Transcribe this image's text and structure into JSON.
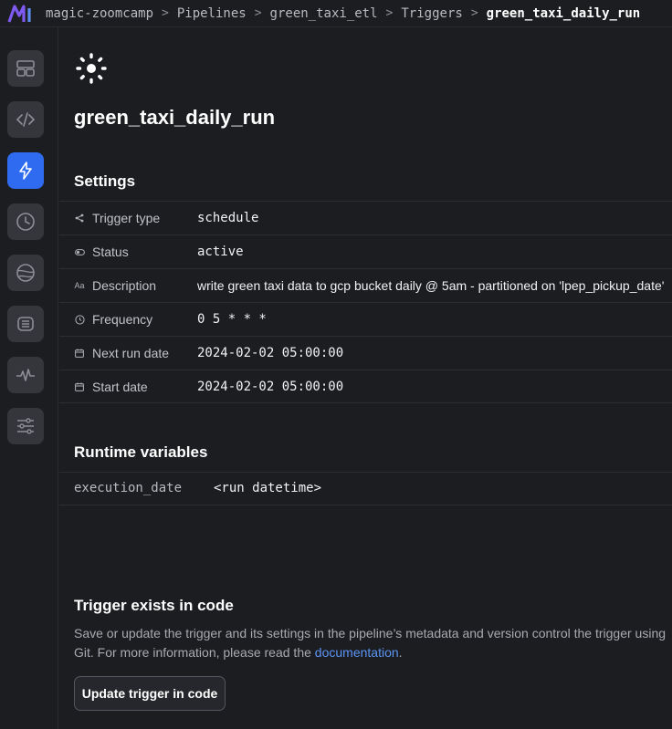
{
  "breadcrumbs": [
    {
      "label": "magic-zoomcamp"
    },
    {
      "label": "Pipelines"
    },
    {
      "label": "green_taxi_etl"
    },
    {
      "label": "Triggers"
    },
    {
      "label": "green_taxi_daily_run"
    }
  ],
  "sidebar": {
    "items": [
      {
        "icon": "dashboard-icon",
        "active": false
      },
      {
        "icon": "code-icon",
        "active": false
      },
      {
        "icon": "lightning-icon",
        "active": true
      },
      {
        "icon": "clock-icon",
        "active": false
      },
      {
        "icon": "globe-icon",
        "active": false
      },
      {
        "icon": "logs-icon",
        "active": false
      },
      {
        "icon": "activity-icon",
        "active": false
      },
      {
        "icon": "settings-sliders-icon",
        "active": false
      }
    ]
  },
  "trigger": {
    "icon": "sun-icon",
    "name": "green_taxi_daily_run"
  },
  "settings": {
    "title": "Settings",
    "rows": [
      {
        "label": "Trigger type",
        "icon": "share-icon",
        "value": "schedule"
      },
      {
        "label": "Status",
        "icon": "toggle-icon",
        "value": "active"
      },
      {
        "label": "Description",
        "icon": "text-aa-icon",
        "value": "write green taxi data to gcp bucket daily @ 5am - partitioned on 'lpep_pickup_date'"
      },
      {
        "label": "Frequency",
        "icon": "clock-icon",
        "value": "0 5 * * *"
      },
      {
        "label": "Next run date",
        "icon": "calendar-icon",
        "value": "2024-02-02 05:00:00"
      },
      {
        "label": "Start date",
        "icon": "calendar-icon",
        "value": "2024-02-02 05:00:00"
      }
    ]
  },
  "runtime": {
    "title": "Runtime variables",
    "key": "execution_date",
    "value": "<run datetime>"
  },
  "code_section": {
    "title": "Trigger exists in code",
    "description_prefix": "Save or update the trigger and its settings in the pipeline’s metadata and version control the trigger using Git. For more information, please read the ",
    "link_label": "documentation",
    "description_suffix": ".",
    "button_label": "Update trigger in code"
  },
  "colors": {
    "accent": "#2e6bf0",
    "status_active": "#3fcc4e",
    "link": "#5b95f5",
    "background": "#1c1d21"
  }
}
